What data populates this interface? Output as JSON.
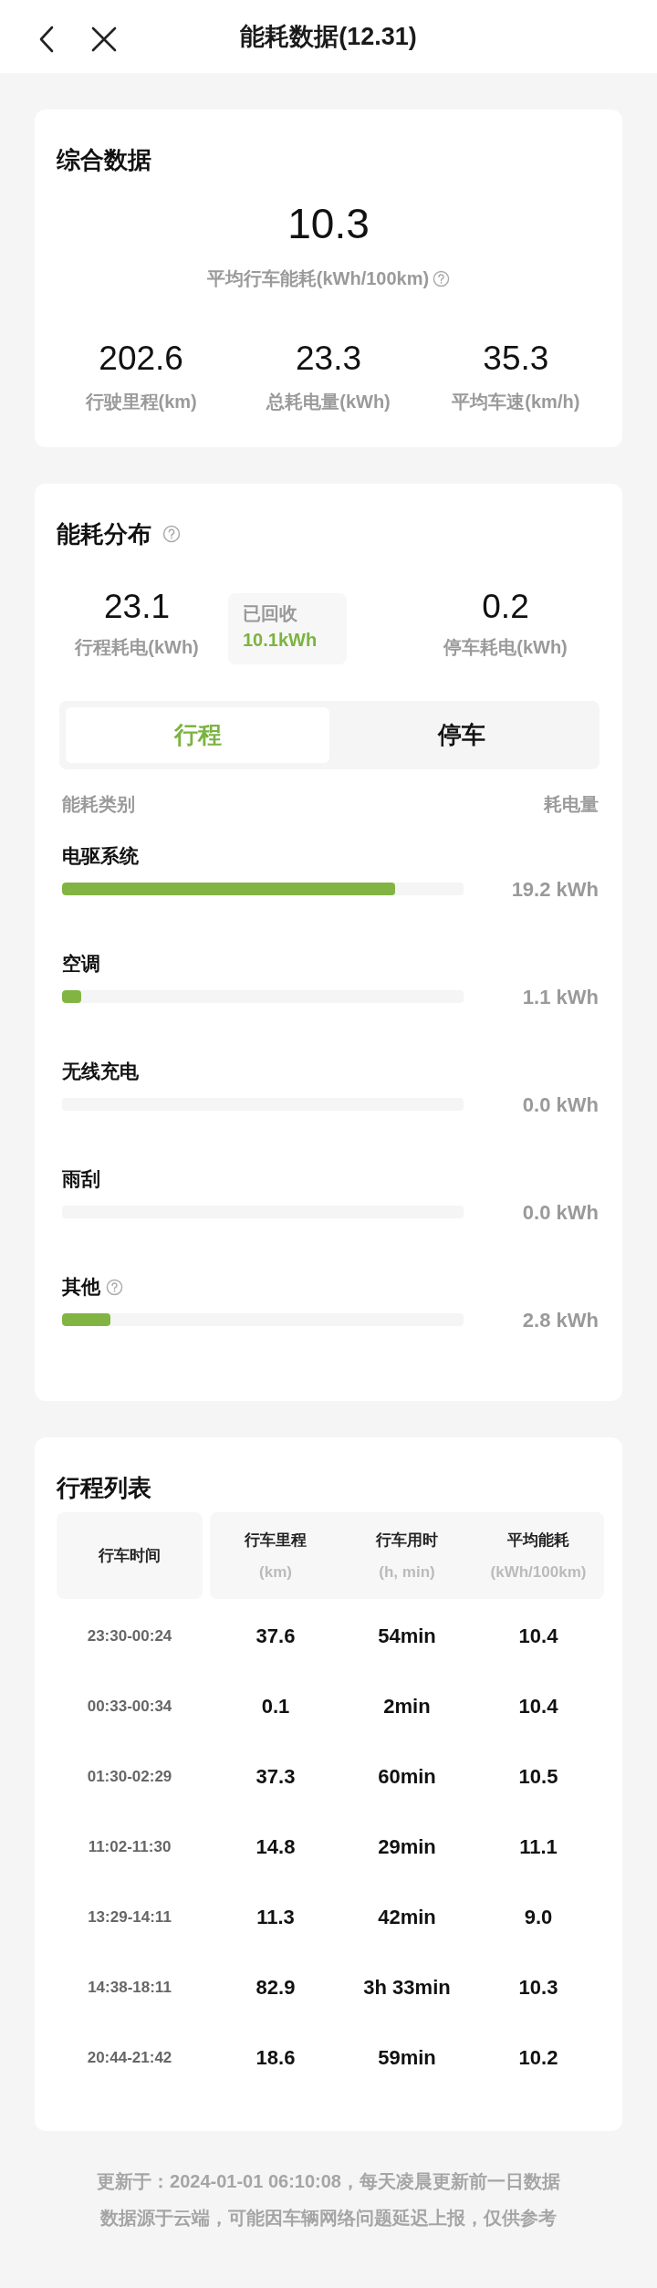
{
  "header": {
    "title": "能耗数据(12.31)"
  },
  "summary": {
    "title": "综合数据",
    "main": {
      "value": "10.3",
      "label": "平均行车能耗(kWh/100km)",
      "help": true
    },
    "stats": [
      {
        "value": "202.6",
        "label": "行驶里程(km)"
      },
      {
        "value": "23.3",
        "label": "总耗电量(kWh)"
      },
      {
        "value": "35.3",
        "label": "平均车速(km/h)"
      }
    ]
  },
  "distribution": {
    "title": "能耗分布",
    "help": true,
    "trip": {
      "value": "23.1",
      "label": "行程耗电(kWh)"
    },
    "recovered": {
      "label": "已回收",
      "value": "10.1kWh"
    },
    "parking": {
      "value": "0.2",
      "label": "停车耗电(kWh)"
    },
    "tabs": [
      {
        "label": "行程",
        "selected": true
      },
      {
        "label": "停车",
        "selected": false
      }
    ],
    "columns": [
      "能耗类别",
      "耗电量"
    ],
    "items": [
      {
        "name": "电驱系统",
        "help": false,
        "level": 0.83,
        "reading": "19.2 kWh"
      },
      {
        "name": "空调",
        "help": false,
        "level": 0.047,
        "reading": "1.1 kWh"
      },
      {
        "name": "无线充电",
        "help": false,
        "reading": "0.0 kWh"
      },
      {
        "name": "雨刮",
        "help": false,
        "reading": "0.0 kWh"
      },
      {
        "name": "其他",
        "help": true,
        "level": 0.12,
        "reading": "2.8 kWh"
      }
    ]
  },
  "trips": {
    "title": "行程列表",
    "columns": [
      {
        "label": "行车时间"
      },
      {
        "label": "行车里程",
        "unit": "(km)"
      },
      {
        "label": "行车用时",
        "unit": "(h, min)"
      },
      {
        "label": "平均能耗",
        "unit": "(kWh/100km)"
      }
    ],
    "rows": [
      [
        "23:30-00:24",
        "37.6",
        "54min",
        "10.4"
      ],
      [
        "00:33-00:34",
        "0.1",
        "2min",
        "10.4"
      ],
      [
        "01:30-02:29",
        "37.3",
        "60min",
        "10.5"
      ],
      [
        "11:02-11:30",
        "14.8",
        "29min",
        "11.1"
      ],
      [
        "13:29-14:11",
        "11.3",
        "42min",
        "9.0"
      ],
      [
        "14:38-18:11",
        "82.9",
        "3h 33min",
        "10.3"
      ],
      [
        "20:44-21:42",
        "18.6",
        "59min",
        "10.2"
      ]
    ]
  },
  "footer": [
    "更新于：2024-01-01 06:10:08，每天凌晨更新前一日数据",
    "数据源于云端，可能因车辆网络问题延迟上报，仅供参考"
  ]
}
